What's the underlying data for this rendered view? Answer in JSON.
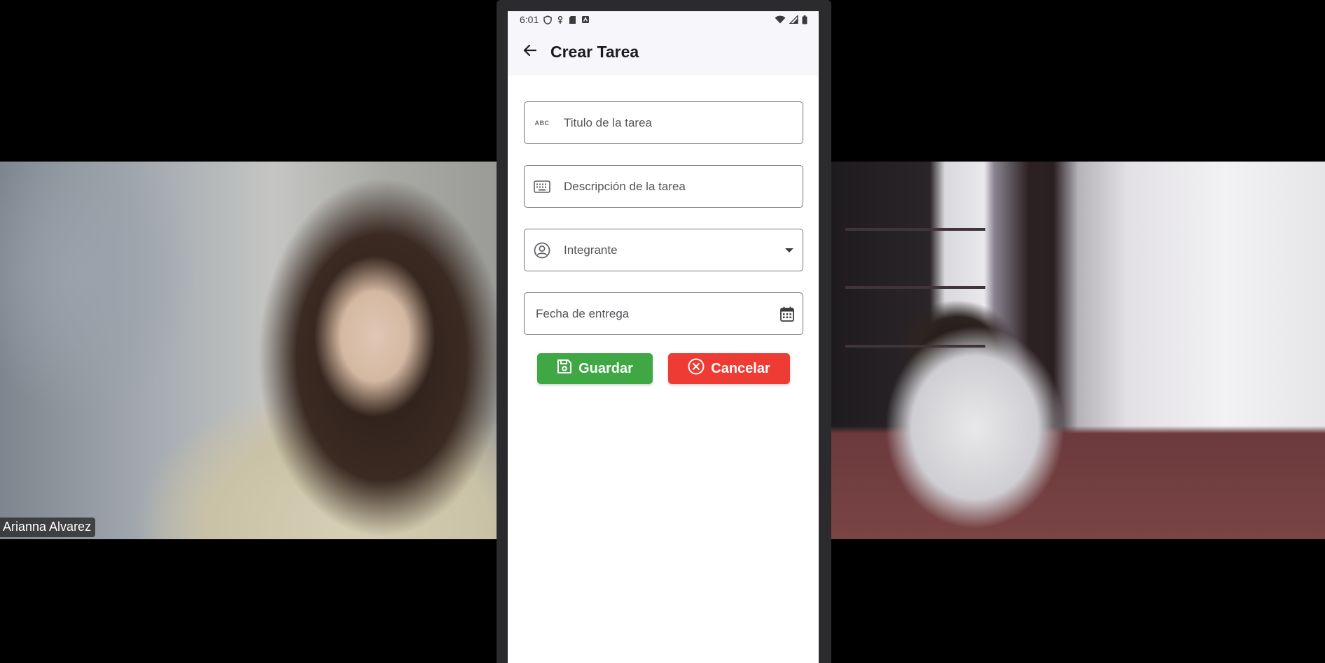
{
  "participants": {
    "left_name": "Arianna Alvarez"
  },
  "status_bar": {
    "time": "6:01"
  },
  "app_bar": {
    "title": "Crear Tarea"
  },
  "form": {
    "title_field": {
      "placeholder": "Titulo de la tarea",
      "icon": "abc-icon",
      "icon_text": "ABC"
    },
    "description_field": {
      "placeholder": "Descripción de la tarea",
      "icon": "keyboard-icon"
    },
    "member_select": {
      "placeholder": "Integrante",
      "icon": "account-circle-icon",
      "trailing_icon": "dropdown-arrow-icon"
    },
    "date_field": {
      "placeholder": "Fecha de entrega",
      "trailing_icon": "calendar-icon"
    }
  },
  "actions": {
    "save_label": "Guardar",
    "cancel_label": "Cancelar"
  },
  "colors": {
    "save": "#3fa844",
    "cancel": "#ee3b33",
    "app_bar_bg": "#f7f7fb"
  }
}
